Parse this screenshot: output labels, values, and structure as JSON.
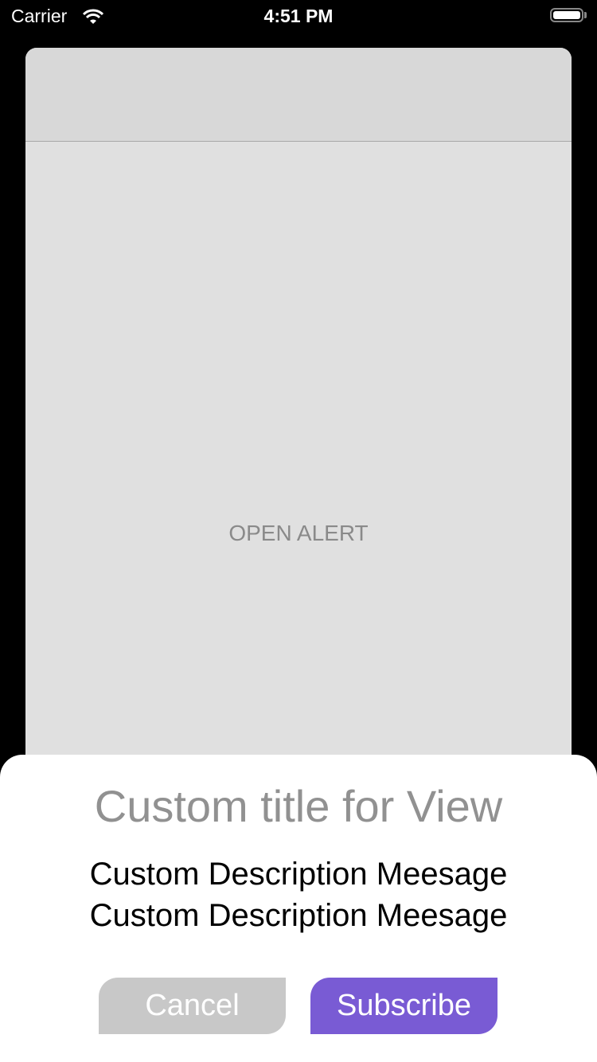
{
  "status_bar": {
    "carrier": "Carrier",
    "time": "4:51 PM"
  },
  "main": {
    "open_alert_label": "OPEN ALERT"
  },
  "alert": {
    "title": "Custom title for View",
    "description_lines": [
      "Custom Description Meesage",
      "Custom Description Meesage"
    ],
    "cancel_label": "Cancel",
    "subscribe_label": "Subscribe"
  },
  "colors": {
    "accent": "#795bd4",
    "cancel": "#c8c8c8",
    "title": "#919191"
  }
}
